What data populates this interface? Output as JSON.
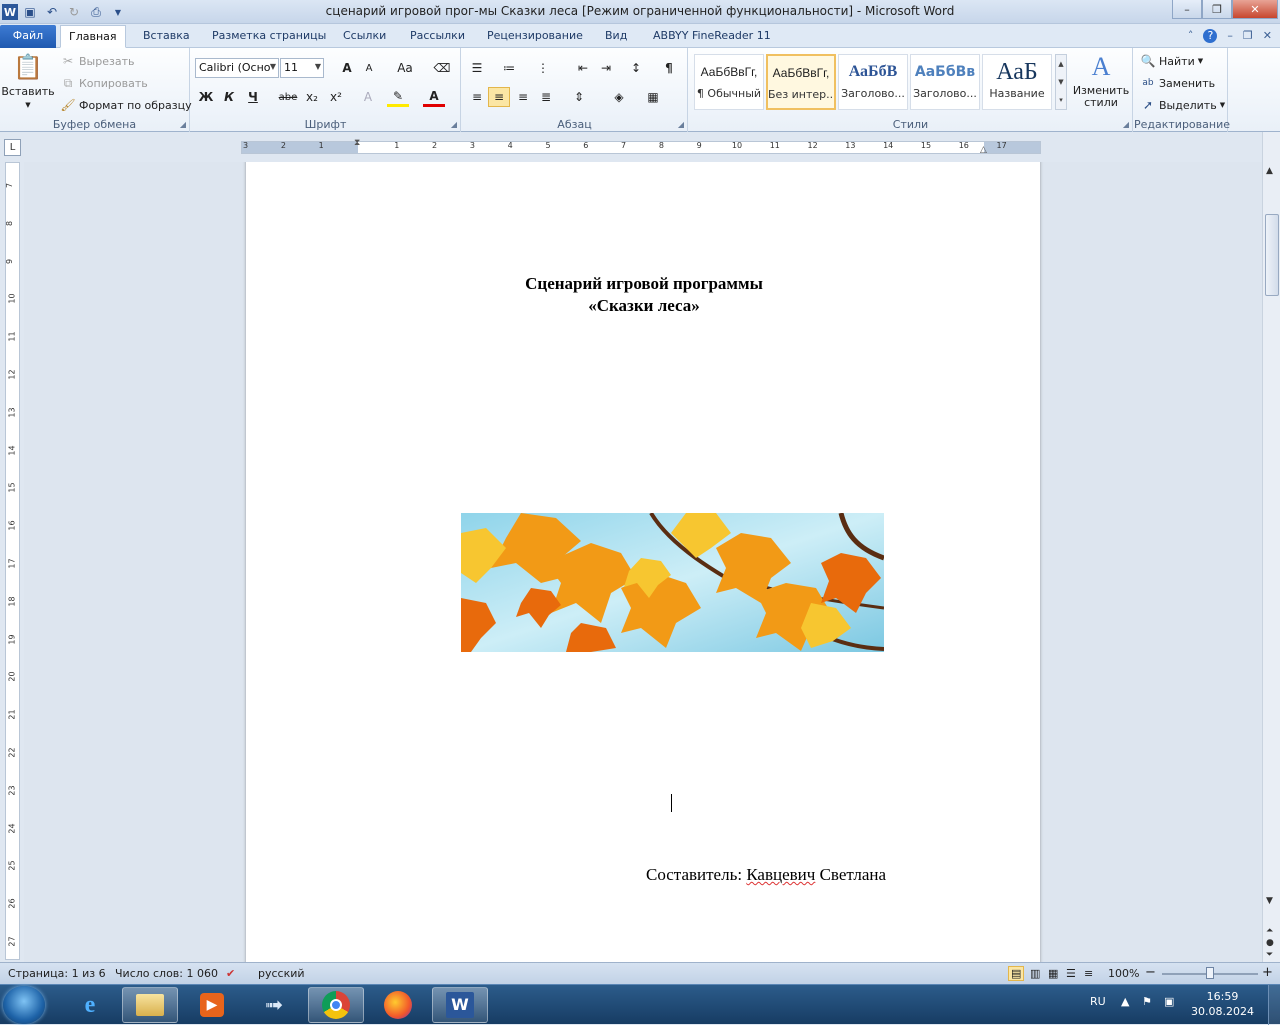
{
  "window": {
    "title": "сценарий игровой прог-мы Сказки леса [Режим ограниченной функциональности]  -  Microsoft Word",
    "minimize": "–",
    "restore": "❐",
    "close": "✕"
  },
  "qat": {
    "save_icon": "save-icon",
    "undo_icon": "undo-icon",
    "redo_icon": "redo-icon",
    "print_icon": "print-preview-icon"
  },
  "tabs": [
    {
      "label": "Файл"
    },
    {
      "label": "Главная"
    },
    {
      "label": "Вставка"
    },
    {
      "label": "Разметка страницы"
    },
    {
      "label": "Ссылки"
    },
    {
      "label": "Рассылки"
    },
    {
      "label": "Рецензирование"
    },
    {
      "label": "Вид"
    },
    {
      "label": "ABBYY FineReader 11"
    }
  ],
  "ribbon": {
    "clipboard": {
      "label": "Буфер обмена",
      "paste": "Вставить",
      "cut": "Вырезать",
      "copy": "Копировать",
      "format_painter": "Формат по образцу"
    },
    "font": {
      "label": "Шрифт",
      "font_name": "Calibri (Осно",
      "font_size": "11",
      "bold": "Ж",
      "italic": "К",
      "underline": "Ч",
      "strike": "abe",
      "subscript": "x₂",
      "superscript": "x²",
      "grow": "A",
      "shrink": "A",
      "case": "Aa"
    },
    "paragraph": {
      "label": "Абзац",
      "pilcrow": "¶"
    },
    "styles": {
      "label": "Стили",
      "items": [
        {
          "sample": "АаБбВвГг,",
          "name": "¶ Обычный"
        },
        {
          "sample": "АаБбВвГг,",
          "name": "Без интер..."
        },
        {
          "sample": "АаБбВ",
          "name": "Заголово..."
        },
        {
          "sample": "АаБбВв",
          "name": "Заголово..."
        },
        {
          "sample": "АаБ",
          "name": "Название"
        }
      ],
      "change_styles": "Изменить стили"
    },
    "editing": {
      "label": "Редактирование",
      "find": "Найти",
      "replace": "Заменить",
      "select": "Выделить"
    }
  },
  "ruler": {
    "h_numbers": [
      "3",
      "2",
      "1",
      "1",
      "2",
      "3",
      "4",
      "5",
      "6",
      "7",
      "8",
      "9",
      "10",
      "11",
      "12",
      "13",
      "14",
      "15",
      "16",
      "17"
    ],
    "v_numbers": [
      "7",
      "8",
      "9",
      "10",
      "11",
      "12",
      "13",
      "14",
      "15",
      "16",
      "17",
      "18",
      "19",
      "20",
      "21",
      "22",
      "23",
      "24",
      "25",
      "26",
      "27"
    ]
  },
  "document": {
    "title_line1": "Сценарий игровой программы",
    "title_line2": "«Сказки леса»",
    "author_label": "Составитель: ",
    "author_surname": "Кавцевич",
    "author_name": " Светлана"
  },
  "statusbar": {
    "page": "Страница: 1 из 6",
    "words": "Число слов: 1 060",
    "language": "русский",
    "zoom": "100%",
    "zoom_minus": "−",
    "zoom_plus": "+"
  },
  "taskbar": {
    "lang": "RU",
    "time": "16:59",
    "date": "30.08.2024"
  },
  "colors": {
    "accent": "#2b579a",
    "file_tab": "#1f59b0",
    "taskbar": "#1d4670"
  }
}
